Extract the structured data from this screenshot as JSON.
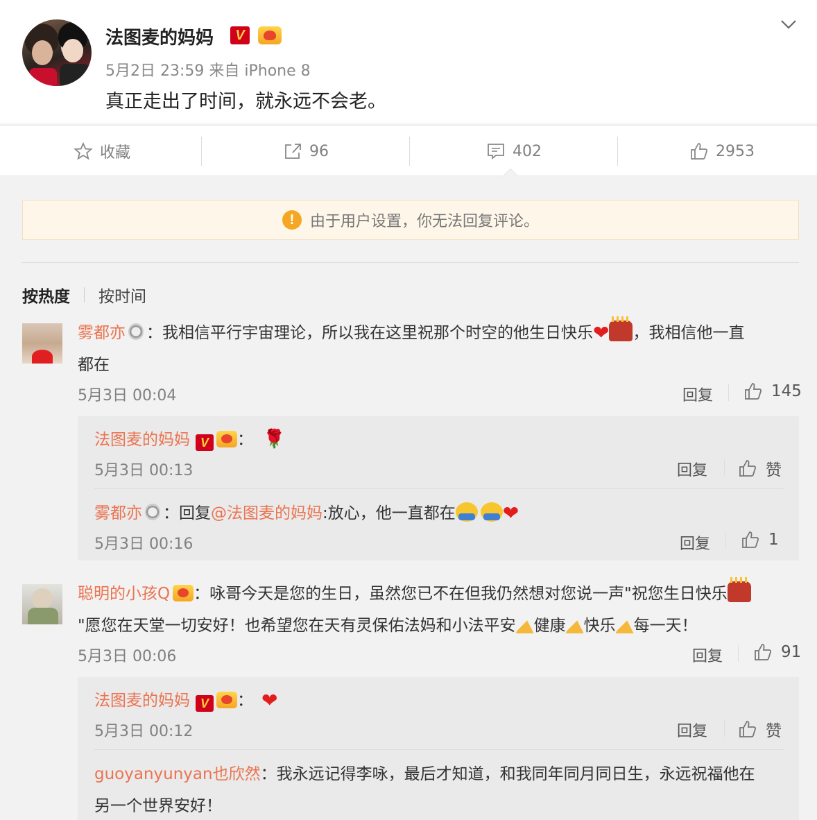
{
  "post": {
    "author": "法图麦的妈妈",
    "verified_badge": "V",
    "meta": "5月2日 23:59 来自 iPhone 8",
    "text": "真正走出了时间，就永远不会老。"
  },
  "actions": {
    "favorite_label": "收藏",
    "repost_count": "96",
    "comment_count": "402",
    "like_count": "2953"
  },
  "notice": {
    "text": "由于用户设置，你无法回复评论。",
    "icon": "!"
  },
  "sort": {
    "active": "按热度",
    "other": "按时间"
  },
  "comments": [
    {
      "user": "雾都亦",
      "text_a": "：我相信平行宇宙理论，所以我在这里祝那个时空的他生日快乐",
      "text_b": "，我相信他一直",
      "text_c": "都在",
      "time": "5月3日 00:04",
      "reply_label": "回复",
      "likes": "145",
      "replies": [
        {
          "user": "法图麦的妈妈",
          "badge": "V",
          "sep": "：",
          "time": "5月3日 00:13",
          "reply_label": "回复",
          "likes": "赞"
        },
        {
          "user": "雾都亦",
          "prefix": "：回复",
          "mention": "@法图麦的妈妈",
          "text": ":放心，他一直都在",
          "time": "5月3日 00:16",
          "reply_label": "回复",
          "likes": "1"
        }
      ]
    },
    {
      "user": "聪明的小孩Q",
      "text_a": "：咏哥今天是您的生日，虽然您已不在但我仍然想对您说一声\"祝您生日快乐",
      "text_b1": "\"愿您在天堂一切安好！也希望您在天有灵保佑法妈和小法平安",
      "text_b2": "健康",
      "text_b3": "快乐",
      "text_b4": "每一天！",
      "time": "5月3日 00:06",
      "reply_label": "回复",
      "likes": "91",
      "replies": [
        {
          "user": "法图麦的妈妈",
          "badge": "V",
          "sep": "：",
          "time": "5月3日 00:12",
          "reply_label": "回复",
          "likes": "赞"
        },
        {
          "user": "guoyanyunyan也欣然",
          "text_a": "：我永远记得李咏，最后才知道，和我同年同月同日生，永远祝福他在",
          "text_b": "另一个世界安好！"
        }
      ]
    }
  ]
}
